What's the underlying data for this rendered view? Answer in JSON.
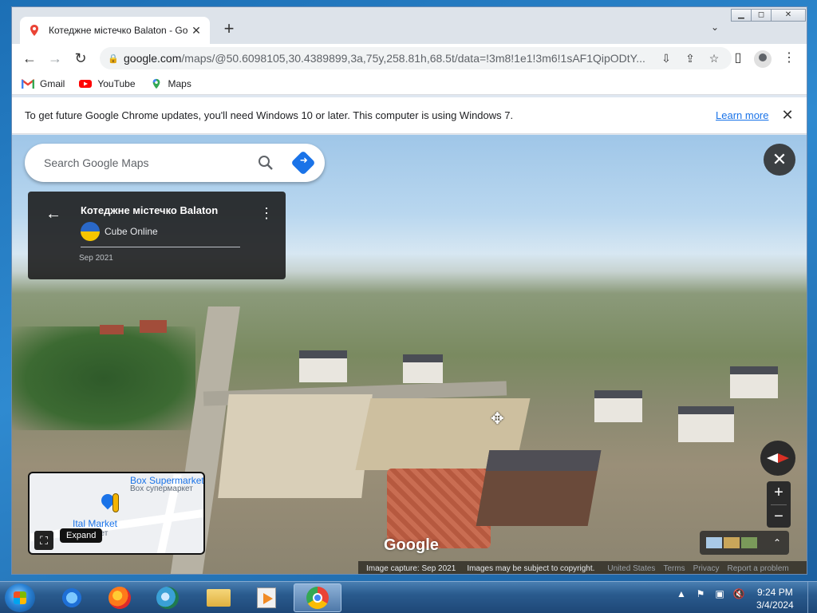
{
  "browser": {
    "tab_title": "Котеджне містечко Balaton - Go",
    "url_host": "google.com",
    "url_rest": "/maps/@50.6098105,30.4389899,3a,75y,258.81h,68.5t/data=!3m8!1e1!3m6!1sAF1QipODtY...",
    "bookmarks": [
      {
        "label": "Gmail",
        "icon": "gmail-icon"
      },
      {
        "label": "YouTube",
        "icon": "youtube-icon"
      },
      {
        "label": "Maps",
        "icon": "maps-icon"
      }
    ],
    "infobar_text": "To get future Google Chrome updates, you'll need Windows 10 or later. This computer is using Windows 7.",
    "infobar_link": "Learn more"
  },
  "maps": {
    "search_placeholder": "Search Google Maps",
    "place_title": "Котеджне містечко Balaton",
    "author": "Cube Online",
    "date": "Sep 2021",
    "minimap": {
      "label1": "Box Supermarket",
      "label1_sub": "Box супермаркет",
      "label2": "Ital Market",
      "label2_sub": "маркет",
      "expand_tip": "Expand"
    },
    "google_logo": "Google",
    "footer": {
      "capture": "Image capture: Sep 2021",
      "copyright": "Images may be subject to copyright.",
      "country": "United States",
      "terms": "Terms",
      "privacy": "Privacy",
      "report": "Report a problem"
    }
  },
  "taskbar": {
    "apps": [
      "internet-explorer-icon",
      "firefox-icon",
      "edge-icon",
      "file-explorer-icon",
      "media-player-icon",
      "chrome-icon"
    ],
    "time": "9:24 PM",
    "date": "3/4/2024"
  }
}
